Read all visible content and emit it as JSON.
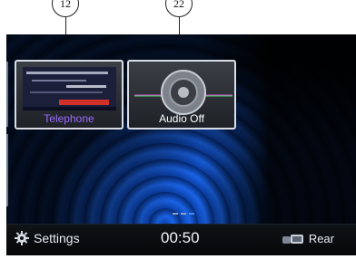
{
  "callouts": [
    "12",
    "22"
  ],
  "tiles": [
    {
      "label": "Telephone",
      "label_color": "#9a6bff",
      "icon": "telephone-thumbnail"
    },
    {
      "label": "Audio Off",
      "label_color": "#ffffff",
      "icon": "speaker-icon"
    }
  ],
  "pager": {
    "pages": 3,
    "active_index": 2
  },
  "bottom_bar": {
    "settings_label": "Settings",
    "settings_icon": "gear-icon",
    "clock": "00:50",
    "rear_label": "Rear",
    "rear_icon": "rear-seat-icon"
  },
  "colors": {
    "accent": "#3a8cff",
    "background_blue": "#1a63e6"
  }
}
